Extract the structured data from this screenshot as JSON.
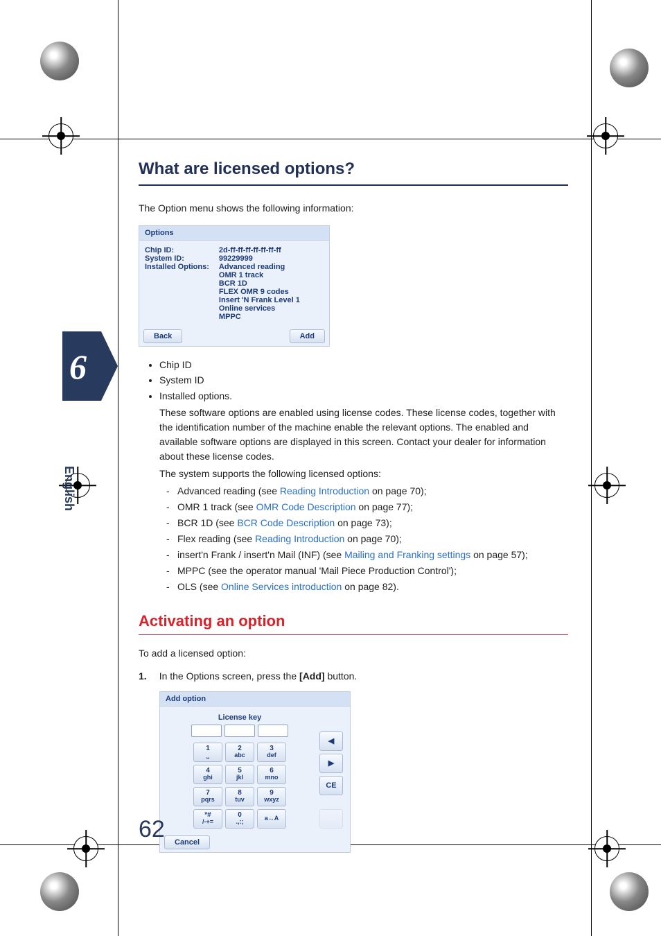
{
  "section_title": "What are licensed options?",
  "intro": "The Option menu shows the following information:",
  "options_panel": {
    "title": "Options",
    "labels": {
      "chip": "Chip ID:",
      "system": "System ID:",
      "installed": "Installed Options:"
    },
    "values": {
      "chip": "2d-ff-ff-ff-ff-ff-ff-ff",
      "system": "99229999",
      "installed": [
        "Advanced reading",
        "OMR 1 track",
        "BCR 1D",
        "FLEX OMR 9 codes",
        "Insert 'N Frank Level 1",
        "Online services",
        "MPPC"
      ]
    },
    "back": "Back",
    "add": "Add"
  },
  "bullets": [
    "Chip ID",
    "System ID",
    "Installed options."
  ],
  "explain1": "These software options are enabled using license codes. These license codes, together with the identification number of the machine enable the relevant options. The enabled and available software options are displayed in this screen. Contact your dealer for information about these license codes.",
  "explain2": "The system supports the following licensed options:",
  "licensed": [
    {
      "pre": "Advanced reading (see ",
      "link": "Reading Introduction",
      "post": " on page 70);"
    },
    {
      "pre": "OMR 1 track (see ",
      "link": "OMR Code Description",
      "post": " on page 77);"
    },
    {
      "pre": "BCR 1D (see ",
      "link": "BCR Code Description",
      "post": " on page 73);"
    },
    {
      "pre": "Flex reading (see ",
      "link": "Reading Introduction",
      "post": " on page 70);"
    },
    {
      "pre": "insert'n Frank / insert'n Mail (INF) (see ",
      "link": "Mailing and Franking settings",
      "post": " on page 57);"
    },
    {
      "pre": "MPPC (see the operator manual 'Mail Piece Production Control');",
      "link": "",
      "post": ""
    },
    {
      "pre": "OLS (see ",
      "link": "Online Services introduction",
      "post": " on page 82)."
    }
  ],
  "activating_title": "Activating an option",
  "add_intro": "To add a licensed option:",
  "step1_num": "1.",
  "step1_text_a": "In the Options screen, press the ",
  "step1_text_b": "[Add]",
  "step1_text_c": " button.",
  "addopt_panel": {
    "title": "Add option",
    "license_label": "License key",
    "keys": [
      {
        "n": "1",
        "l": "⎵"
      },
      {
        "n": "2",
        "l": "abc"
      },
      {
        "n": "3",
        "l": "def"
      },
      {
        "n": "4",
        "l": "ghi"
      },
      {
        "n": "5",
        "l": "jkl"
      },
      {
        "n": "6",
        "l": "mno"
      },
      {
        "n": "7",
        "l": "pqrs"
      },
      {
        "n": "8",
        "l": "tuv"
      },
      {
        "n": "9",
        "l": "wxyz"
      },
      {
        "n": "*#",
        "l": "/-+="
      },
      {
        "n": "0",
        "l": ".,:;"
      },
      {
        "n": "",
        "l": "a↔A"
      }
    ],
    "side": {
      "left": "◀",
      "right": "▶",
      "ce": "CE"
    },
    "cancel": "Cancel"
  },
  "chapter": "6",
  "language_side": "English",
  "page_number": "62"
}
